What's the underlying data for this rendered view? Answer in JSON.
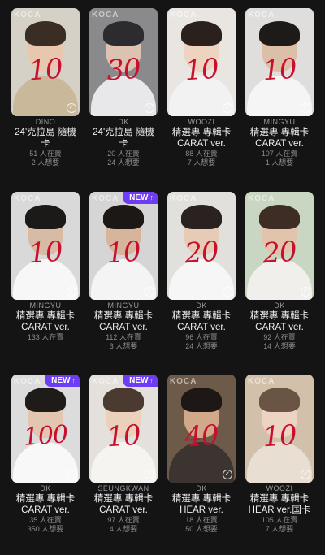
{
  "watermark": "KOCA",
  "badge": {
    "new": "NEW"
  },
  "cards": [
    {
      "member": "DINO",
      "title_lines": [
        "24'克拉島 隨機",
        "卡"
      ],
      "price": "10",
      "sellers": "51 人在賣",
      "wanted": "2 人想要",
      "new": false,
      "bg": "#d6d1c6",
      "skin": "#e7c8ae",
      "hair": "#3a2d24",
      "top": "#c9b99a"
    },
    {
      "member": "DK",
      "title_lines": [
        "24'克拉島 隨機",
        "卡"
      ],
      "price": "30",
      "sellers": "20 人在賣",
      "wanted": "24 人想要",
      "new": false,
      "bg": "#8a8a8c",
      "skin": "#dcc2b0",
      "hair": "#2b2b30",
      "top": "#e8e8ea"
    },
    {
      "member": "WOOZI",
      "title_lines": [
        "精選專 專輯卡",
        "CARAT ver."
      ],
      "price": "10",
      "sellers": "88 人在賣",
      "wanted": "7 人想要",
      "new": false,
      "bg": "#e9e6e2",
      "skin": "#edd3c0",
      "hair": "#2a211c",
      "top": "#f2f2f2"
    },
    {
      "member": "MINGYU",
      "title_lines": [
        "精選專 專輯卡",
        "CARAT ver."
      ],
      "price": "10",
      "sellers": "107 人在賣",
      "wanted": "1 人想要",
      "new": false,
      "bg": "#dfdedd",
      "skin": "#dcbfa8",
      "hair": "#1e1a18",
      "top": "#f5f5f5"
    },
    {
      "member": "MINGYU",
      "title_lines": [
        "精選專 專輯卡",
        "CARAT ver."
      ],
      "price": "10",
      "sellers": "133 人在賣",
      "wanted": "",
      "new": false,
      "bg": "#d9d9d9",
      "skin": "#d8bba4",
      "hair": "#1c1a19",
      "top": "#f7f7f7"
    },
    {
      "member": "MINGYU",
      "title_lines": [
        "精選專 專輯卡",
        "CARAT ver."
      ],
      "price": "10",
      "sellers": "112 人在賣",
      "wanted": "3 人想要",
      "new": true,
      "bg": "#d5d5d5",
      "skin": "#d6b59c",
      "hair": "#1b1816",
      "top": "#f4f4f4"
    },
    {
      "member": "DK",
      "title_lines": [
        "精選專 專輯卡",
        "CARAT ver."
      ],
      "price": "20",
      "sellers": "96 人在賣",
      "wanted": "24 人想要",
      "new": false,
      "bg": "#e2e0dd",
      "skin": "#e6cbb6",
      "hair": "#2a2220",
      "top": "#f6f6f6"
    },
    {
      "member": "DK",
      "title_lines": [
        "精選專 專輯卡",
        "CARAT ver."
      ],
      "price": "20",
      "sellers": "92 人在賣",
      "wanted": "14 人想要",
      "new": false,
      "bg": "#c9d6c2",
      "skin": "#e2c4ad",
      "hair": "#3d2d24",
      "top": "#f0efeb"
    },
    {
      "member": "DK",
      "title_lines": [
        "精選專 專輯卡",
        "CARAT ver."
      ],
      "price": "100",
      "sellers": "35 人在賣",
      "wanted": "350 人想要",
      "new": true,
      "bg": "#dcdcdc",
      "skin": "#e3c6b1",
      "hair": "#1f1b19",
      "top": "#f8f8f8"
    },
    {
      "member": "SEUNGKWAN",
      "title_lines": [
        "精選專 專輯卡",
        "CARAT ver."
      ],
      "price": "10",
      "sellers": "97 人在賣",
      "wanted": "4 人想要",
      "new": true,
      "bg": "#e4e1dc",
      "skin": "#ebd0bb",
      "hair": "#4a3a30",
      "top": "#f5f4f1"
    },
    {
      "member": "DK",
      "title_lines": [
        "精選專 專輯卡",
        "HEAR ver."
      ],
      "price": "40",
      "sellers": "18 人在賣",
      "wanted": "50 人想要",
      "new": false,
      "bg": "#6e5a48",
      "skin": "#d1a98a",
      "hair": "#1d1815",
      "top": "#3b3430"
    },
    {
      "member": "WOOZI",
      "title_lines": [
        "精選專 專輯卡",
        "HEAR ver.国卡"
      ],
      "price": "10",
      "sellers": "105 人在賣",
      "wanted": "7 人想要",
      "new": false,
      "bg": "#d3c0aa",
      "skin": "#edd4c2",
      "hair": "#6a5443",
      "top": "#e9ded2"
    }
  ]
}
